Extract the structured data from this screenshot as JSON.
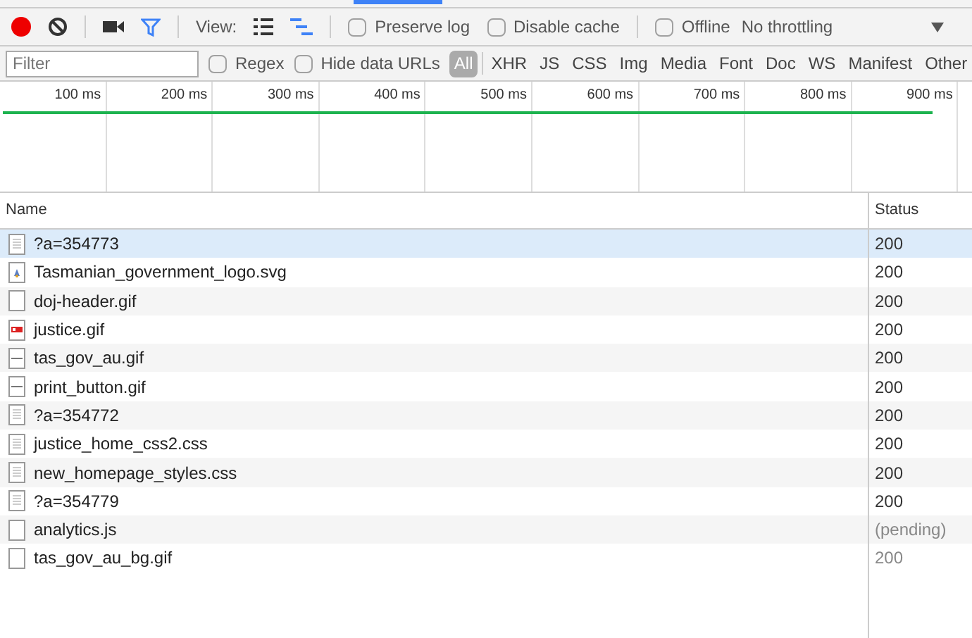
{
  "toolbar": {
    "view_label": "View:",
    "checkboxes": [
      {
        "label": "Preserve log",
        "checked": false
      },
      {
        "label": "Disable cache",
        "checked": false
      },
      {
        "label": "Offline",
        "checked": false
      }
    ],
    "throttling": "No throttling",
    "record": {
      "on": true
    }
  },
  "filter_bar": {
    "placeholder": "Filter",
    "checkboxes": [
      {
        "label": "Regex",
        "checked": false
      },
      {
        "label": "Hide data URLs",
        "checked": false
      }
    ],
    "types": [
      {
        "label": "All",
        "selected": true
      },
      {
        "label": "XHR",
        "selected": false
      },
      {
        "label": "JS",
        "selected": false
      },
      {
        "label": "CSS",
        "selected": false
      },
      {
        "label": "Img",
        "selected": false
      },
      {
        "label": "Media",
        "selected": false
      },
      {
        "label": "Font",
        "selected": false
      },
      {
        "label": "Doc",
        "selected": false
      },
      {
        "label": "WS",
        "selected": false
      },
      {
        "label": "Manifest",
        "selected": false
      },
      {
        "label": "Other",
        "selected": false
      }
    ]
  },
  "overview": {
    "ticks": [
      "100 ms",
      "200 ms",
      "300 ms",
      "400 ms",
      "500 ms",
      "600 ms",
      "700 ms",
      "800 ms",
      "900 ms"
    ]
  },
  "table": {
    "columns": [
      "Name",
      "Status"
    ],
    "rows": [
      {
        "name": "?a=354773",
        "status": "200",
        "kind": "document",
        "selected": true,
        "pending": false
      },
      {
        "name": "Tasmanian_government_logo.svg",
        "status": "200",
        "kind": "logo",
        "selected": false,
        "pending": false
      },
      {
        "name": "doj-header.gif",
        "status": "200",
        "kind": "blank",
        "selected": false,
        "pending": false
      },
      {
        "name": "justice.gif",
        "status": "200",
        "kind": "photo",
        "selected": false,
        "pending": false
      },
      {
        "name": "tas_gov_au.gif",
        "status": "200",
        "kind": "dash",
        "selected": false,
        "pending": false
      },
      {
        "name": "print_button.gif",
        "status": "200",
        "kind": "dash",
        "selected": false,
        "pending": false
      },
      {
        "name": "?a=354772",
        "status": "200",
        "kind": "document",
        "selected": false,
        "pending": false
      },
      {
        "name": "justice_home_css2.css",
        "status": "200",
        "kind": "document",
        "selected": false,
        "pending": false
      },
      {
        "name": "new_homepage_styles.css",
        "status": "200",
        "kind": "document",
        "selected": false,
        "pending": false
      },
      {
        "name": "?a=354779",
        "status": "200",
        "kind": "document",
        "selected": false,
        "pending": false
      },
      {
        "name": "analytics.js",
        "status": "(pending)",
        "kind": "blank",
        "selected": false,
        "pending": true
      },
      {
        "name": "tas_gov_au_bg.gif",
        "status": "200",
        "kind": "blank",
        "selected": false,
        "pending": true
      }
    ]
  }
}
